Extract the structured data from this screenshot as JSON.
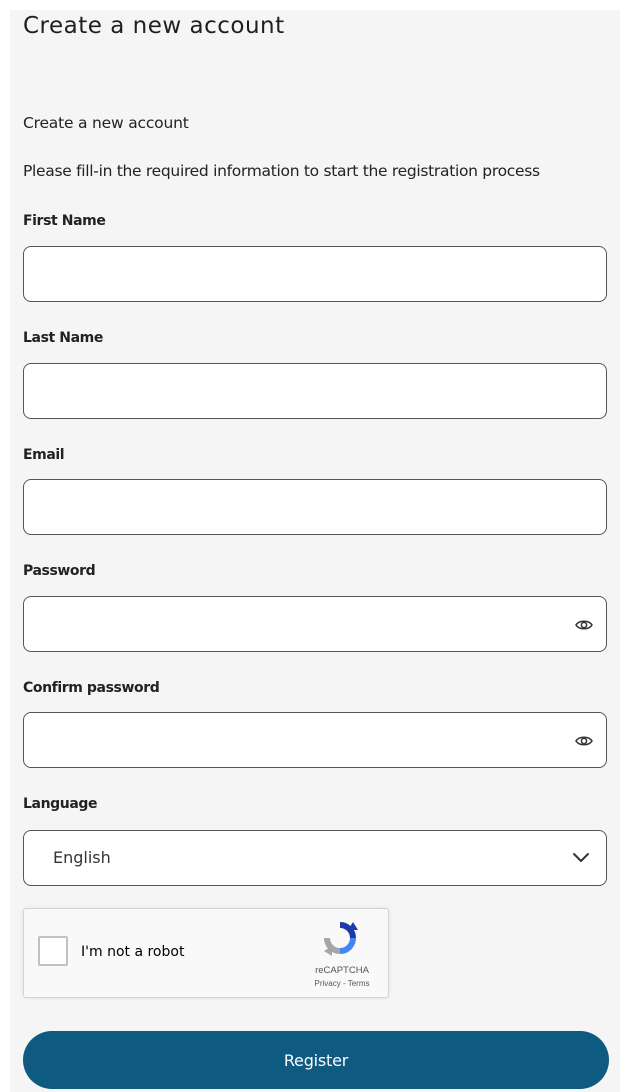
{
  "page": {
    "title": "Create a new account",
    "subtitle": "Create a new account",
    "instructions": "Please fill-in the required information to start the registration process"
  },
  "form": {
    "first_name": {
      "label": "First Name",
      "value": "",
      "placeholder": ""
    },
    "last_name": {
      "label": "Last Name",
      "value": "",
      "placeholder": ""
    },
    "email": {
      "label": "Email",
      "value": "",
      "placeholder": ""
    },
    "password": {
      "label": "Password",
      "value": "",
      "placeholder": "",
      "toggle_icon": "eye-icon"
    },
    "confirm_password": {
      "label": "Confirm password",
      "value": "",
      "placeholder": "",
      "toggle_icon": "eye-icon"
    },
    "language": {
      "label": "Language",
      "selected": "English",
      "icon": "chevron-down-icon"
    }
  },
  "captcha": {
    "label": "I'm not a robot",
    "brand": "reCAPTCHA",
    "privacy_link": "Privacy",
    "separator": " - ",
    "terms_link": "Terms",
    "checked": false
  },
  "actions": {
    "register_label": "Register"
  },
  "colors": {
    "background": "#f5f5f5",
    "input_border": "#555555",
    "primary_button": "#0e5a80",
    "button_text": "#ffffff"
  }
}
